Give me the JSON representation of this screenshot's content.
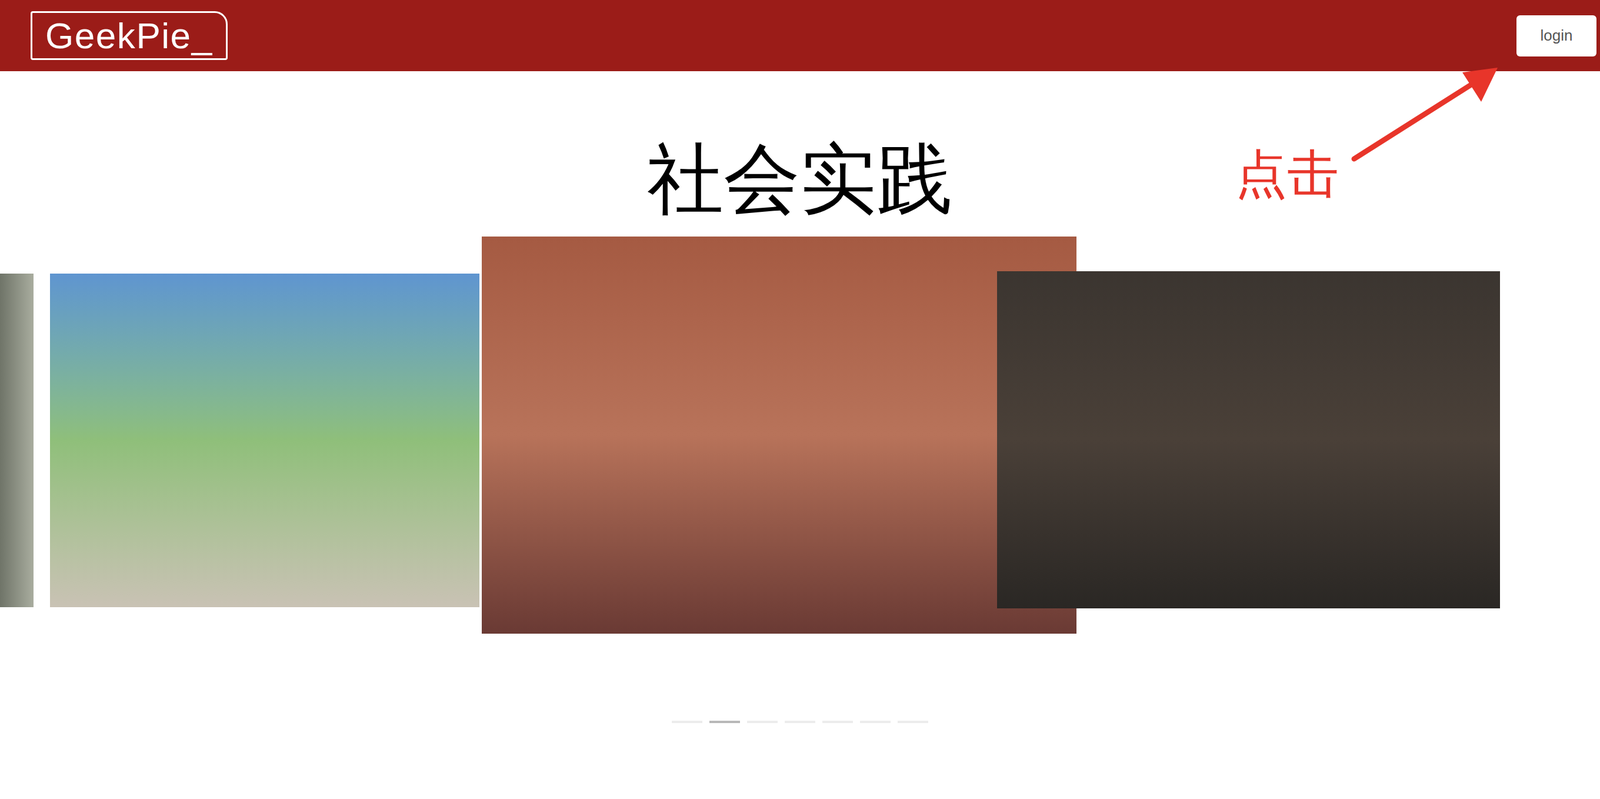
{
  "header": {
    "logo": "GeekPie_",
    "login_button": "login"
  },
  "page": {
    "title": "社会实践"
  },
  "annotation": {
    "text": "点击"
  },
  "carousel": {
    "indicators": [
      {
        "selected": false
      },
      {
        "selected": true
      },
      {
        "selected": false
      },
      {
        "selected": false
      },
      {
        "selected": false
      },
      {
        "selected": false
      },
      {
        "selected": false
      }
    ]
  }
}
